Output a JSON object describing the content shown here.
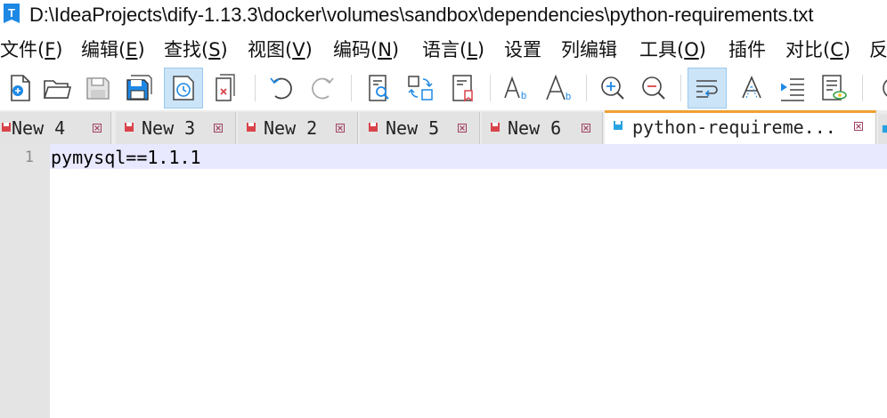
{
  "window": {
    "title": "D:\\IdeaProjects\\dify-1.13.3\\docker\\volumes\\sandbox\\dependencies\\python-requirements.txt",
    "app_icon_letter": "T"
  },
  "menu": [
    {
      "label": "文件(",
      "hotkey": "F",
      "suffix": ")"
    },
    {
      "label": "编辑(",
      "hotkey": "E",
      "suffix": ")"
    },
    {
      "label": "查找(",
      "hotkey": "S",
      "suffix": ")"
    },
    {
      "label": "视图(",
      "hotkey": "V",
      "suffix": ")"
    },
    {
      "label": "编码(",
      "hotkey": "N",
      "suffix": ")"
    },
    {
      "label": "语言(",
      "hotkey": "L",
      "suffix": ")"
    },
    {
      "label": "设置",
      "hotkey": "",
      "suffix": ""
    },
    {
      "label": "列编辑",
      "hotkey": "",
      "suffix": ""
    },
    {
      "label": "工具(",
      "hotkey": "O",
      "suffix": ")"
    },
    {
      "label": "插件",
      "hotkey": "",
      "suffix": ""
    },
    {
      "label": "对比(",
      "hotkey": "C",
      "suffix": ")"
    },
    {
      "label": "反",
      "hotkey": "",
      "suffix": ""
    }
  ],
  "toolbar": [
    "new-file-icon",
    "open-folder-icon",
    "save-icon",
    "save-all-icon",
    "auto-save-icon",
    "close-file-icon",
    "undo-icon",
    "redo-icon",
    "find-icon",
    "replace-icon",
    "bookmark-icon",
    "font-small-icon",
    "font-large-icon",
    "zoom-in-icon",
    "zoom-out-icon",
    "word-wrap-icon",
    "show-symbols-icon",
    "indent-guide-icon",
    "document-map-icon",
    "more-icon"
  ],
  "tabs": [
    {
      "label": "New 4",
      "modified": true,
      "active": false
    },
    {
      "label": "New 3",
      "modified": true,
      "active": false
    },
    {
      "label": "New 2",
      "modified": true,
      "active": false
    },
    {
      "label": "New 5",
      "modified": true,
      "active": false
    },
    {
      "label": "New 6",
      "modified": true,
      "active": false
    },
    {
      "label": "python-requireme...",
      "modified": false,
      "active": true
    }
  ],
  "editor": {
    "lines": [
      {
        "number": "1",
        "text": "pymysql==1.1.1"
      }
    ]
  },
  "colors": {
    "accent": "#1e88e5",
    "unsaved_tab_icon": "#d9434a",
    "saved_tab_icon": "#29a3e0",
    "active_tab_top": "#f0a030",
    "current_line": "#e8e8ff"
  }
}
